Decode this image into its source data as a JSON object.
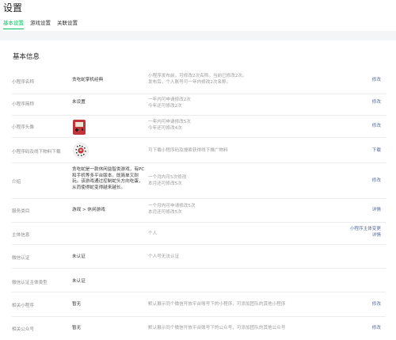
{
  "page": {
    "title": "设置"
  },
  "tabs": [
    {
      "label": "基本设置"
    },
    {
      "label": "游戏设置"
    },
    {
      "label": "关联设置"
    }
  ],
  "section": {
    "title": "基本信息"
  },
  "rows": {
    "name": {
      "label": "小程序名称",
      "value": "贪吃蛇掌机经典",
      "note": [
        "小程序发布前，可修改2次名称。当前已修改2次。",
        "发布后，个人账号可一年内修改2次名称。"
      ],
      "action": "修改"
    },
    "short_name": {
      "label": "小程序简称",
      "value": "未设置",
      "note": [
        "一年内可申请修改2次",
        "今年还可修改2次"
      ],
      "action": "修改"
    },
    "avatar": {
      "label": "小程序头像",
      "note": [
        "一年内可申请修改5次",
        "今年还可修改4次"
      ],
      "action": "修改"
    },
    "qrcode": {
      "label": "小程序码及线下物料下载",
      "note": [
        "可下载小程序码及搜索获得线下推广物料"
      ],
      "action": "下载"
    },
    "intro": {
      "label": "介绍",
      "value": [
        "贪吃蛇是一款休闲益智类游戏，有PC",
        "和手机等多平台版本。既简单又耐",
        "玩。该游戏通过控制蛇头方向吃蛋，",
        "从而使得蛇变得越来越长。"
      ],
      "note": [
        "一个月内可5次修改",
        "本月还可修改5次"
      ],
      "action": "修改"
    },
    "category": {
      "label": "服务类目",
      "value": "游戏 > 休闲游戏",
      "note": [
        "一个月内可申请修改5次",
        "本月还可修改5次"
      ],
      "action": "详情"
    },
    "subject": {
      "label": "主体信息",
      "note": [
        "个人"
      ],
      "action": [
        "小程序主体变更",
        "详情"
      ]
    },
    "wechat_verify": {
      "label": "微信认证",
      "value": "未认证",
      "note": [
        "个人号无法认证"
      ]
    },
    "verify_subject_type": {
      "label": "微信认证主体类型",
      "value": "未认证"
    },
    "related_miniprogram": {
      "label": "相关小程序",
      "value": "暂无",
      "note": [
        "默认展示同个微信开放平台账号下的小程序，可添加团队的其他小程序"
      ],
      "action": "修改"
    },
    "related_official_account": {
      "label": "相关公众号",
      "value": "暂无",
      "note": [
        "默认展示同个微信开放平台账号下的公众号，可添加团队的其他公众号"
      ],
      "action": "修改"
    }
  },
  "colors": {
    "accent": "#07c160",
    "link": "#576b95",
    "band": "#f4f5f7"
  },
  "icons": {
    "avatar": "gameboy-avatar-icon",
    "qrcode": "miniprogram-code-icon"
  }
}
